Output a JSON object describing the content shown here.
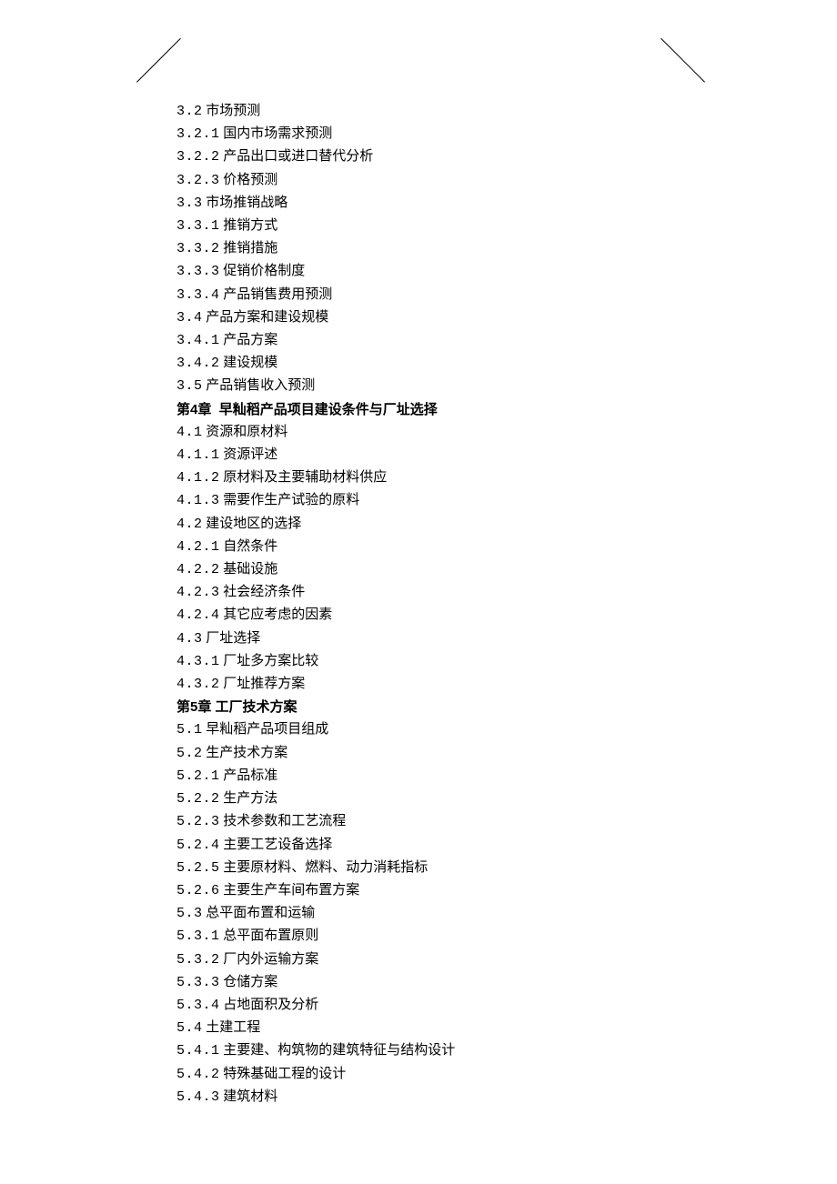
{
  "toc": [
    {
      "num": "3.2",
      "text": "市场预测",
      "bold": false
    },
    {
      "num": "3.2.1",
      "text": "国内市场需求预测",
      "bold": false
    },
    {
      "num": "3.2.2",
      "text": "产品出口或进口替代分析",
      "bold": false
    },
    {
      "num": "3.2.3",
      "text": "价格预测",
      "bold": false
    },
    {
      "num": "3.3",
      "text": "市场推销战略",
      "bold": false
    },
    {
      "num": "3.3.1",
      "text": "推销方式",
      "bold": false
    },
    {
      "num": "3.3.2",
      "text": "推销措施",
      "bold": false
    },
    {
      "num": "3.3.3",
      "text": "促销价格制度",
      "bold": false
    },
    {
      "num": "3.3.4",
      "text": "产品销售费用预测",
      "bold": false
    },
    {
      "num": "3.4",
      "text": "产品方案和建设规模",
      "bold": false
    },
    {
      "num": "3.4.1",
      "text": "产品方案",
      "bold": false
    },
    {
      "num": "3.4.2",
      "text": "建设规模",
      "bold": false
    },
    {
      "num": "3.5",
      "text": "产品销售收入预测",
      "bold": false
    },
    {
      "num": "第4章",
      "text": "早籼稻产品项目建设条件与厂址选择",
      "bold": true,
      "gap": true
    },
    {
      "num": "4.1",
      "text": "资源和原材料",
      "bold": false
    },
    {
      "num": "4.1.1",
      "text": "资源评述",
      "bold": false
    },
    {
      "num": "4.1.2",
      "text": "原材料及主要辅助材料供应",
      "bold": false
    },
    {
      "num": "4.1.3",
      "text": "需要作生产试验的原料",
      "bold": false
    },
    {
      "num": "4.2",
      "text": "建设地区的选择",
      "bold": false
    },
    {
      "num": "4.2.1",
      "text": "自然条件",
      "bold": false
    },
    {
      "num": "4.2.2",
      "text": "基础设施",
      "bold": false
    },
    {
      "num": "4.2.3",
      "text": "社会经济条件",
      "bold": false
    },
    {
      "num": "4.2.4",
      "text": "其它应考虑的因素",
      "bold": false
    },
    {
      "num": "4.3",
      "text": "厂址选择",
      "bold": false
    },
    {
      "num": "4.3.1",
      "text": "厂址多方案比较",
      "bold": false
    },
    {
      "num": "4.3.2",
      "text": "厂址推荐方案",
      "bold": false
    },
    {
      "num": "第5章",
      "text": "工厂技术方案",
      "bold": true
    },
    {
      "num": "5.1",
      "text": "早籼稻产品项目组成",
      "bold": false
    },
    {
      "num": "5.2",
      "text": "生产技术方案",
      "bold": false
    },
    {
      "num": "5.2.1",
      "text": "产品标准",
      "bold": false
    },
    {
      "num": "5.2.2",
      "text": "生产方法",
      "bold": false
    },
    {
      "num": "5.2.3",
      "text": "技术参数和工艺流程",
      "bold": false
    },
    {
      "num": "5.2.4",
      "text": "主要工艺设备选择",
      "bold": false
    },
    {
      "num": "5.2.5",
      "text": "主要原材料、燃料、动力消耗指标",
      "bold": false
    },
    {
      "num": "5.2.6",
      "text": "主要生产车间布置方案",
      "bold": false
    },
    {
      "num": "5.3",
      "text": "总平面布置和运输",
      "bold": false
    },
    {
      "num": "5.3.1",
      "text": "总平面布置原则",
      "bold": false
    },
    {
      "num": "5.3.2",
      "text": "厂内外运输方案",
      "bold": false
    },
    {
      "num": "5.3.3",
      "text": "仓储方案",
      "bold": false
    },
    {
      "num": "5.3.4",
      "text": "占地面积及分析",
      "bold": false
    },
    {
      "num": "5.4",
      "text": "土建工程",
      "bold": false
    },
    {
      "num": "5.4.1",
      "text": "主要建、构筑物的建筑特征与结构设计",
      "bold": false
    },
    {
      "num": "5.4.2",
      "text": "特殊基础工程的设计",
      "bold": false
    },
    {
      "num": "5.4.3",
      "text": "建筑材料",
      "bold": false
    }
  ]
}
